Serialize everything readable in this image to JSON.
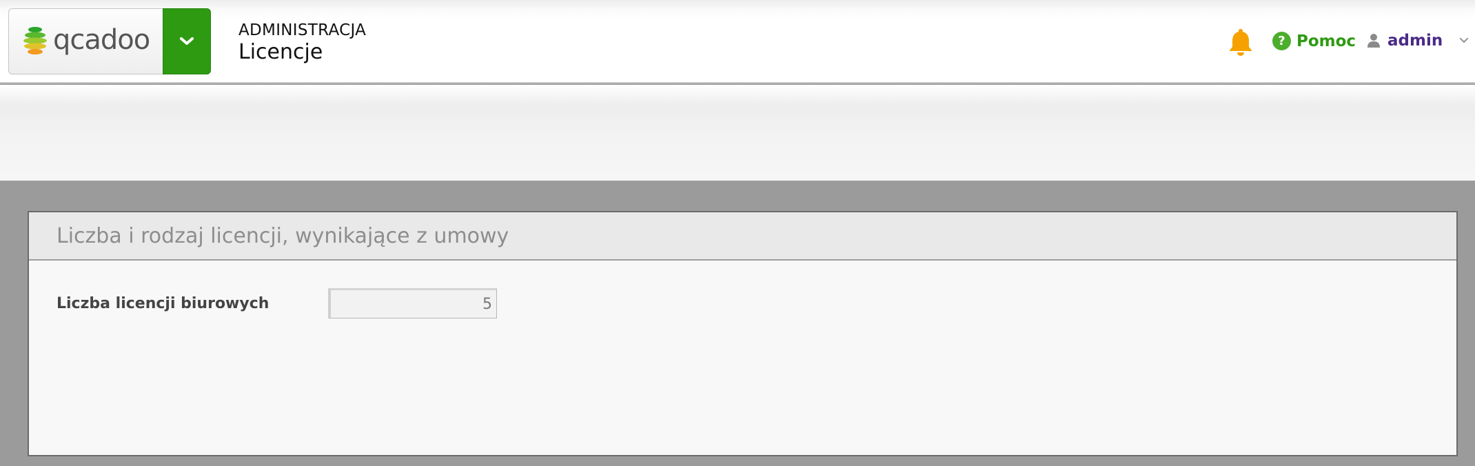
{
  "header": {
    "logo_text": "qcadoo",
    "breadcrumb": "ADMINISTRACJA",
    "page_title": "Licencje",
    "help_label": "Pomoc",
    "help_icon_glyph": "?",
    "user_name": "admin"
  },
  "panel": {
    "title": "Liczba i rodzaj licencji, wynikające z umowy",
    "fields": [
      {
        "label": "Liczba licencji biurowych",
        "value": "5"
      }
    ]
  },
  "colors": {
    "brand_green": "#2e9a12",
    "bell_orange": "#f5a200",
    "user_purple": "#4a2b87"
  },
  "icons": {
    "menu_toggle": "chevron-down-icon",
    "notifications": "bell-icon",
    "help": "question-circle-icon",
    "user": "user-icon",
    "user_menu": "chevron-down-icon"
  }
}
